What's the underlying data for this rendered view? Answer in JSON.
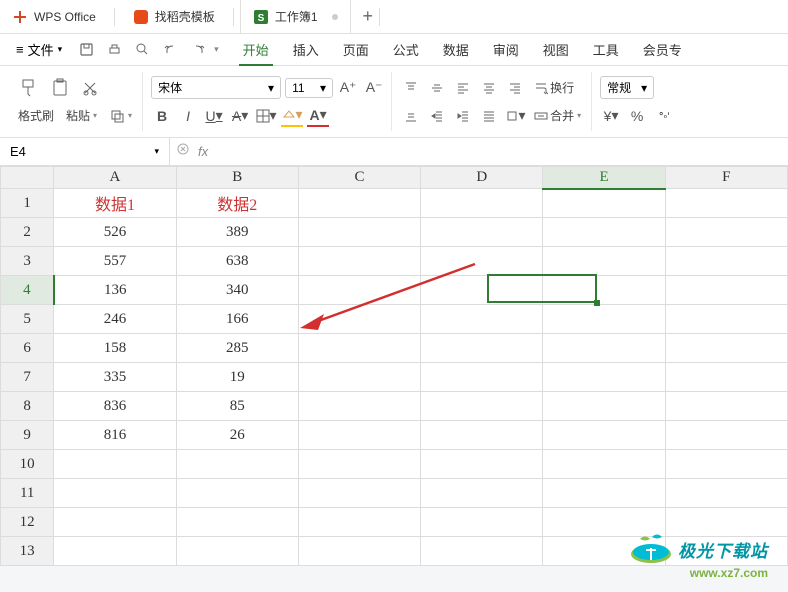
{
  "title_bar": {
    "app": "WPS Office",
    "template": "找稻壳模板",
    "doc": "工作簿1",
    "add": "+"
  },
  "menu_bar": {
    "file": "文件",
    "tabs": [
      "开始",
      "插入",
      "页面",
      "公式",
      "数据",
      "审阅",
      "视图",
      "工具",
      "会员专"
    ]
  },
  "ribbon": {
    "format_painter": "格式刷",
    "paste": "粘贴",
    "font": "宋体",
    "size": "11",
    "bold": "B",
    "italic": "I",
    "under": "U",
    "strike": "A",
    "fontsize_up": "A⁺",
    "fontsize_down": "A⁻",
    "wrap": "换行",
    "merge": "合并",
    "format": "常规",
    "currency": "¥",
    "percent": "%"
  },
  "namebox": {
    "ref": "E4",
    "fx": "fx"
  },
  "columns": [
    "A",
    "B",
    "C",
    "D",
    "E",
    "F"
  ],
  "rows": [
    "1",
    "2",
    "3",
    "4",
    "5",
    "6",
    "7",
    "8",
    "9",
    "10",
    "11",
    "12",
    "13"
  ],
  "headers": {
    "A": "数据1",
    "B": "数据2"
  },
  "chart_data": {
    "type": "table",
    "categories": [
      "数据1",
      "数据2"
    ],
    "series": [
      {
        "name": "数据1",
        "values": [
          526,
          557,
          136,
          246,
          158,
          335,
          836,
          816
        ]
      },
      {
        "name": "数据2",
        "values": [
          389,
          638,
          340,
          166,
          285,
          19,
          85,
          26
        ]
      }
    ]
  },
  "sel": {
    "col": "E",
    "row": "4",
    "col_idx": 4,
    "row_idx": 3
  },
  "watermark": {
    "name": "极光下载站",
    "url": "www.xz7.com"
  }
}
